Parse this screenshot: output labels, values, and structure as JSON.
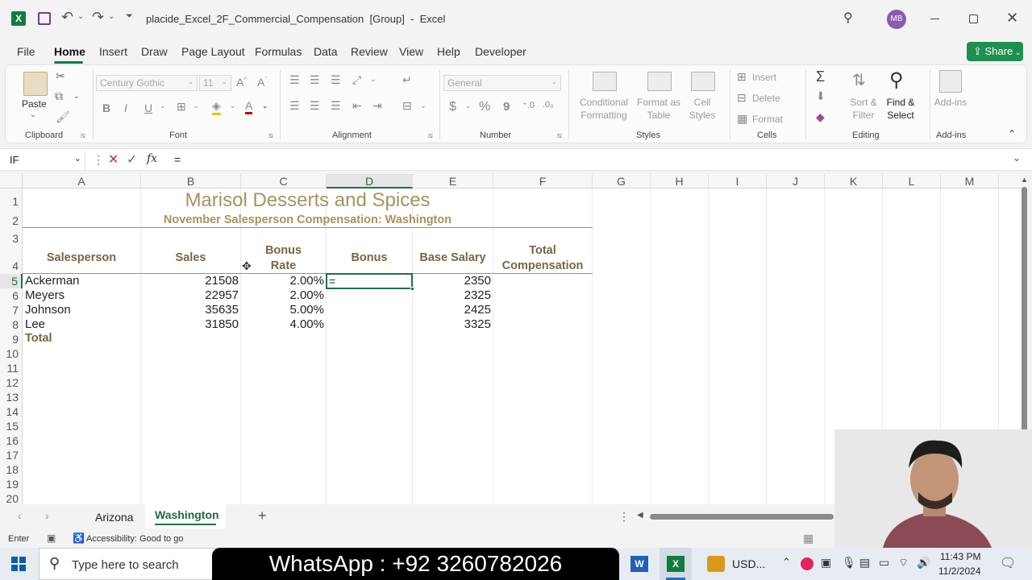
{
  "window": {
    "app_icon": "excel-logo-icon",
    "title": "placide_Excel_2F_Commercial_Compensation  [Group]  -  Excel",
    "user_initials": "MB"
  },
  "menu": [
    "File",
    "Home",
    "Insert",
    "Draw",
    "Page Layout",
    "Formulas",
    "Data",
    "Review",
    "View",
    "Help",
    "Developer"
  ],
  "share_label": "Share",
  "ribbon": {
    "clipboard": {
      "paste": "Paste",
      "group": "Clipboard"
    },
    "font": {
      "name": "Century Gothic",
      "size": "11",
      "group": "Font",
      "bold": "B",
      "italic": "I",
      "underline": "U"
    },
    "alignment": {
      "group": "Alignment"
    },
    "number": {
      "format": "General",
      "group": "Number",
      "currency": "$",
      "percent": "%",
      "comma": "9"
    },
    "styles": {
      "conditional": "Conditional\nFormatting",
      "format_table": "Format as\nTable",
      "cell_styles": "Cell\nStyles",
      "group": "Styles"
    },
    "cells": {
      "insert": "Insert",
      "delete": "Delete",
      "format": "Format",
      "group": "Cells"
    },
    "editing": {
      "sort": "Sort &\nFilter",
      "find": "Find &\nSelect",
      "group": "Editing"
    },
    "addins": {
      "label": "Add-ins",
      "group": "Add-ins"
    }
  },
  "formula_bar": {
    "name_box": "IF",
    "content": "="
  },
  "columns": [
    "A",
    "B",
    "C",
    "D",
    "E",
    "F",
    "G",
    "H",
    "I",
    "J",
    "K",
    "L",
    "M"
  ],
  "rows": [
    "1",
    "2",
    "3",
    "4",
    "5",
    "6",
    "7",
    "8",
    "9",
    "10",
    "11",
    "12",
    "13",
    "14",
    "15",
    "16",
    "17",
    "18",
    "19",
    "20"
  ],
  "sheet": {
    "title": "Marisol Desserts and Spices",
    "subtitle": "November Salesperson Compensation: Washington",
    "headers": {
      "salesperson": "Salesperson",
      "sales": "Sales",
      "bonus_rate": "Bonus\nRate",
      "bonus": "Bonus",
      "base_salary": "Base Salary",
      "total_comp": "Total\nCompensation"
    },
    "rows": [
      {
        "name": "Ackerman",
        "sales": "21508",
        "rate": "2.00%",
        "bonus": "=",
        "base": "2350"
      },
      {
        "name": "Meyers",
        "sales": "22957",
        "rate": "2.00%",
        "bonus": "",
        "base": "2325"
      },
      {
        "name": "Johnson",
        "sales": "35635",
        "rate": "5.00%",
        "bonus": "",
        "base": "2425"
      },
      {
        "name": "Lee",
        "sales": "31850",
        "rate": "4.00%",
        "bonus": "",
        "base": "3325"
      }
    ],
    "total_label": "Total"
  },
  "tabs": [
    "Arizona",
    "Washington"
  ],
  "active_tab": "Washington",
  "status": {
    "mode": "Enter",
    "accessibility": "Accessibility: Good to go"
  },
  "taskbar": {
    "search_placeholder": "Type here to search",
    "banner": "WhatsApp : +92 3260782026",
    "currency": "USD...",
    "time": "11:43 PM",
    "date": "11/2/2024"
  },
  "colors": {
    "accent": "#107c41",
    "header_text": "#7a6642",
    "border_red": "#d7776f",
    "share_bg": "#1e8f4e"
  }
}
